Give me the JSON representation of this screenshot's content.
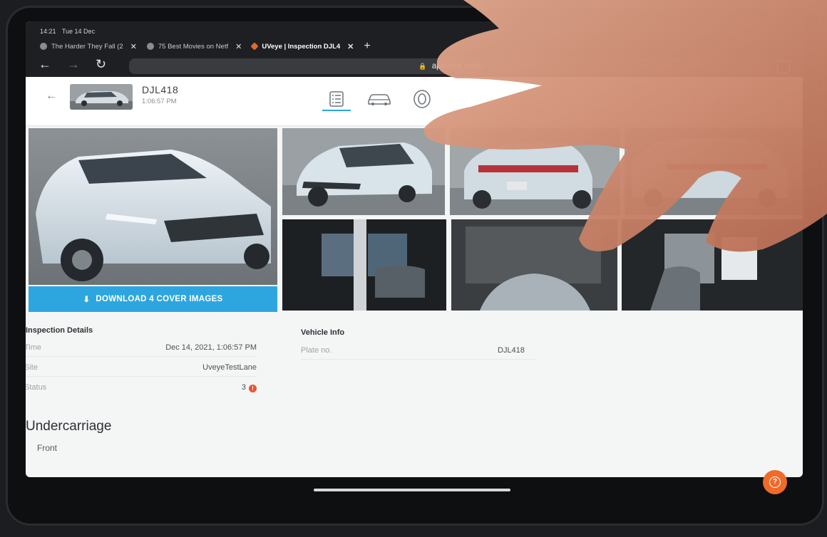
{
  "status_bar": {
    "time": "14:21",
    "date": "Tue 14 Dec"
  },
  "browser": {
    "tabs": [
      {
        "label": "The Harder They Fall (2",
        "active": false
      },
      {
        "label": "75 Best Movies on Netf",
        "active": false
      },
      {
        "label": "UVeye | Inspection DJL4",
        "active": true
      }
    ],
    "url": "app-usa.uvey"
  },
  "inspection": {
    "plate": "DJL418",
    "time": "1:06:57 PM"
  },
  "download_button": "DOWNLOAD 4 COVER IMAGES",
  "inspection_details": {
    "title": "Inspection Details",
    "rows": [
      {
        "label": "Time",
        "value": "Dec 14, 2021, 1:06:57 PM"
      },
      {
        "label": "Site",
        "value": "UveyeTestLane"
      },
      {
        "label": "Status",
        "value": "3"
      }
    ]
  },
  "vehicle_info": {
    "title": "Vehicle Info",
    "rows": [
      {
        "label": "Plate no.",
        "value": "DJL418"
      }
    ]
  },
  "section": {
    "title": "Undercarriage",
    "sub": "Front"
  },
  "icons": {
    "back": "arrow-left-icon",
    "reload": "reload-icon",
    "checklist": "checklist-icon",
    "car": "car-icon",
    "tire": "tire-icon",
    "download": "download-icon",
    "help": "help-icon"
  },
  "colors": {
    "accent": "#2da6df",
    "alert": "#e9542a",
    "help": "#ee6b2a"
  }
}
